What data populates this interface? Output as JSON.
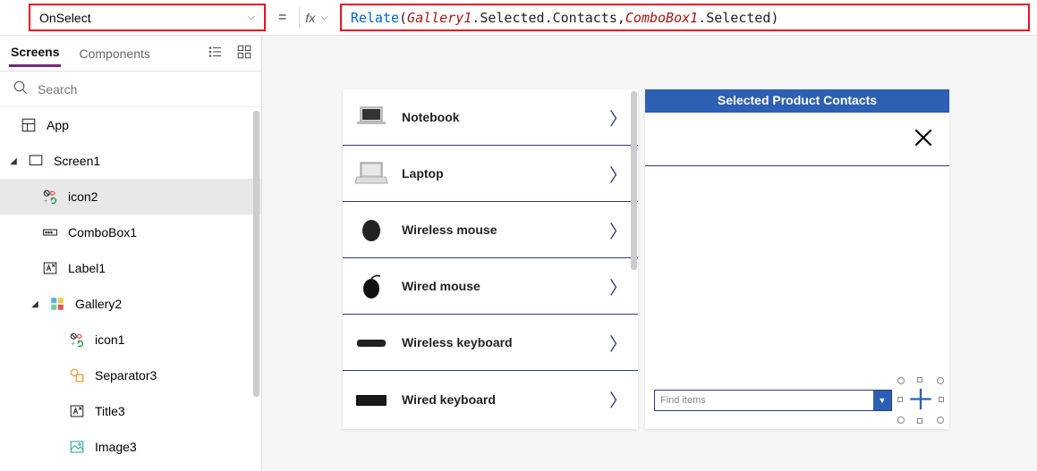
{
  "formula_bar": {
    "property": "OnSelect",
    "fx_label": "fx",
    "tokens": {
      "func": "Relate",
      "open": "( ",
      "id1": "Gallery1",
      "seg1": ".Selected.Contacts, ",
      "id2": "ComboBox1",
      "seg2": ".Selected ",
      "close": ")"
    }
  },
  "panel": {
    "tabs": {
      "screens": "Screens",
      "components": "Components"
    },
    "search_placeholder": "Search",
    "tree": {
      "app": "App",
      "screen1": "Screen1",
      "icon2": "icon2",
      "combobox1": "ComboBox1",
      "label1": "Label1",
      "gallery2": "Gallery2",
      "icon1": "icon1",
      "separator3": "Separator3",
      "title3": "Title3",
      "image3": "Image3"
    }
  },
  "canvas": {
    "products": [
      "Notebook",
      "Laptop",
      "Wireless mouse",
      "Wired mouse",
      "Wireless keyboard",
      "Wired keyboard"
    ],
    "contacts_header": "Selected Product Contacts",
    "combo_placeholder": "Find items"
  }
}
